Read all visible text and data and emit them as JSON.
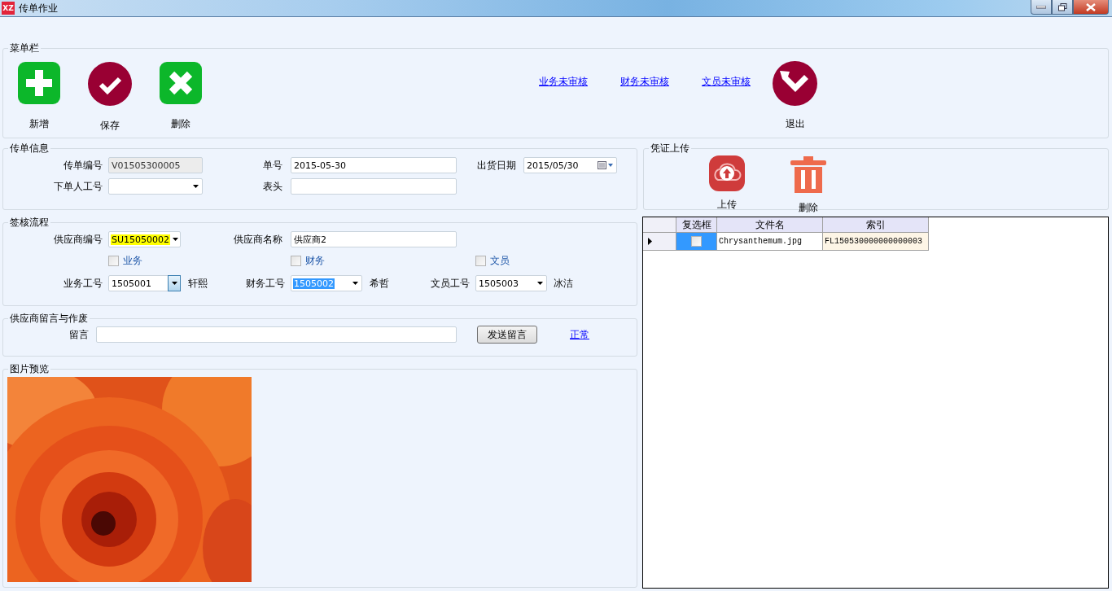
{
  "window": {
    "title": "传单作业",
    "app_badge": "XZ"
  },
  "menu_bar": {
    "title": "菜单栏",
    "buttons": [
      {
        "kind": "add",
        "label": "新增"
      },
      {
        "kind": "save",
        "label": "保存"
      },
      {
        "kind": "delete",
        "label": "删除"
      }
    ],
    "links": [
      "业务未审核",
      "财务未审核",
      "文员未审核"
    ],
    "exit_button": {
      "label": "退出"
    }
  },
  "order_info": {
    "title": "传单信息",
    "fields": [
      {
        "label": "传单编号",
        "kind": "readonly",
        "value": "V01505300005"
      },
      {
        "label": "单号",
        "kind": "text",
        "value": "2015-05-30"
      },
      {
        "label": "出货日期",
        "kind": "date",
        "value": "2015/05/30"
      },
      {
        "label": "下单人工号",
        "kind": "combo"
      },
      {
        "label": "表头",
        "kind": "text"
      }
    ]
  },
  "sign_off": {
    "title": "签核流程",
    "supplier_code": {
      "label": "供应商编号",
      "value": "SU15050002",
      "highlighted": true
    },
    "supplier_name": {
      "label": "供应商名称",
      "value": "供应商2"
    },
    "checkboxes": [
      {
        "label": "业务",
        "checked": false
      },
      {
        "label": "财务",
        "checked": false
      },
      {
        "label": "文员",
        "checked": false
      }
    ],
    "staff": [
      {
        "label": "业务工号",
        "value": "1505001",
        "name": "轩熙",
        "button_hover": true,
        "text_selected": false
      },
      {
        "label": "财务工号",
        "value": "1505002",
        "name": "希哲",
        "button_hover": false,
        "text_selected": true
      },
      {
        "label": "文员工号",
        "value": "1505003",
        "name": "冰洁",
        "button_hover": false,
        "text_selected": false
      }
    ]
  },
  "message": {
    "title": "供应商留言与作废",
    "label": "留言",
    "send_button": "发送留言",
    "status_link": "正常"
  },
  "preview": {
    "title": "图片预览"
  },
  "upload": {
    "title": "凭证上传",
    "buttons": [
      {
        "kind": "upload",
        "label": "上传"
      },
      {
        "kind": "delete",
        "label": "删除"
      }
    ]
  },
  "files": {
    "columns": [
      "复选框",
      "文件名",
      "索引"
    ],
    "rows": [
      {
        "selected": true,
        "checked": false,
        "file_name": "Chrysanthemum.jpg",
        "index": "FL150530000000000003"
      }
    ]
  }
}
